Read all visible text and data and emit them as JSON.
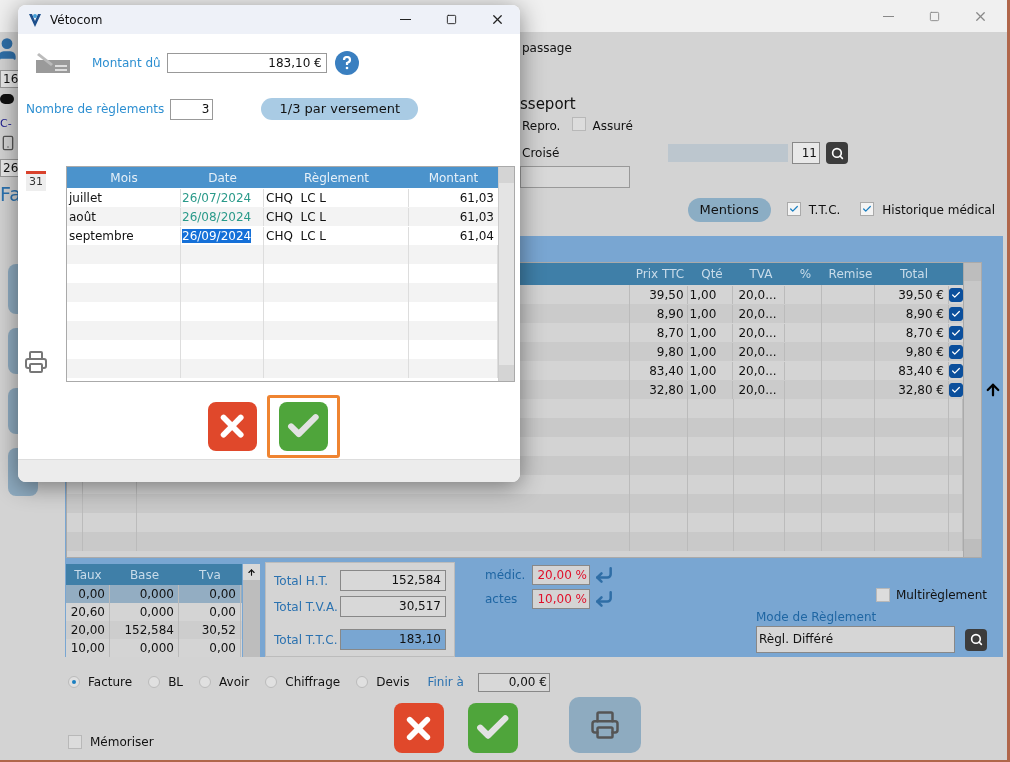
{
  "left_strip": [
    {
      "kind": "avatar"
    },
    {
      "kind": "field",
      "text": "16"
    },
    {
      "kind": "animal"
    },
    {
      "kind": "text",
      "text": "C-"
    },
    {
      "kind": "phone"
    },
    {
      "kind": "field",
      "text": "26"
    },
    {
      "kind": "heading",
      "text": "Fa"
    }
  ],
  "header": {
    "passage": "passage",
    "passport": "sseport",
    "repro": "Repro.",
    "assure": {
      "label": "Assuré",
      "checked": false
    },
    "croise": "Croisé",
    "number": "11",
    "mentions": "Mentions",
    "ttc": {
      "label": "T.T.C.",
      "checked": true
    },
    "historique": {
      "label": "Historique médical",
      "checked": true
    }
  },
  "lines_table": {
    "columns": [
      "Prix TTC",
      "Qté",
      "TVA",
      "%",
      "Remise",
      "Total"
    ],
    "rows": [
      {
        "price": "39,50",
        "qty": "1,00",
        "vat": "20,0...",
        "total": "39,50 €",
        "checked": true
      },
      {
        "price": "8,90",
        "qty": "1,00",
        "vat": "20,0...",
        "total": "8,90 €",
        "checked": true
      },
      {
        "price": "8,70",
        "qty": "1,00",
        "vat": "20,0...",
        "total": "8,70 €",
        "checked": true
      },
      {
        "price": "9,80",
        "qty": "1,00",
        "vat": "20,0...",
        "total": "9,80 €",
        "checked": true
      },
      {
        "price": "83,40",
        "qty": "1,00",
        "vat": "20,0...",
        "total": "83,40 €",
        "checked": true
      },
      {
        "price": "32,80",
        "qty": "1,00",
        "vat": "20,0...",
        "total": "32,80 €",
        "checked": true
      }
    ]
  },
  "vat_table": {
    "columns": [
      "Taux",
      "Base",
      "Tva"
    ],
    "rows": [
      {
        "cells": [
          "0,00",
          "0,000",
          "0,00"
        ],
        "selected": true
      },
      {
        "cells": [
          "20,60",
          "0,000",
          "0,00"
        ],
        "selected": false
      },
      {
        "cells": [
          "20,00",
          "152,584",
          "30,52"
        ],
        "selected": false
      },
      {
        "cells": [
          "10,00",
          "0,000",
          "0,00"
        ],
        "selected": false
      }
    ]
  },
  "totals": [
    {
      "label": "Total H.T.",
      "value": "152,584",
      "emphasized": false
    },
    {
      "label": "Total T.V.A.",
      "value": "30,517",
      "emphasized": false
    },
    {
      "label": "Total T.T.C.",
      "value": "183,10",
      "emphasized": true
    }
  ],
  "rates": [
    {
      "label": "médic.",
      "value": "20,00 %"
    },
    {
      "label": "actes",
      "value": "10,00 %"
    }
  ],
  "multireglement": {
    "label": "Multirèglement",
    "checked": false
  },
  "payment_mode": {
    "label": "Mode de Règlement",
    "value": "Règl. Différé"
  },
  "doc_types": [
    {
      "label": "Facture",
      "selected": true
    },
    {
      "label": "BL",
      "selected": false
    },
    {
      "label": "Avoir",
      "selected": false
    },
    {
      "label": "Chiffrage",
      "selected": false
    },
    {
      "label": "Devis",
      "selected": false
    }
  ],
  "finish": {
    "label": "Finir à",
    "value": "0,00 €"
  },
  "memoriser": {
    "label": "Mémoriser",
    "checked": false
  },
  "dialog": {
    "title": "Vétocom",
    "calendar_day": "31",
    "amount": {
      "label": "Montant dû",
      "value": "183,10 €"
    },
    "count": {
      "label": "Nombre de règlements",
      "value": "3"
    },
    "split_button": "1/3 par versement",
    "table": {
      "columns": [
        "Mois",
        "Date",
        "Règlement",
        "Montant"
      ],
      "rows": [
        {
          "month": "juillet",
          "date": "26/07/2024",
          "method": "CHQ  LC L",
          "amount": "61,03",
          "selected": false
        },
        {
          "month": "août",
          "date": "26/08/2024",
          "method": "CHQ  LC L",
          "amount": "61,03",
          "selected": false
        },
        {
          "month": "septembre",
          "date": "26/09/2024",
          "method": "CHQ  LC L",
          "amount": "61,04",
          "selected": true
        }
      ]
    }
  }
}
